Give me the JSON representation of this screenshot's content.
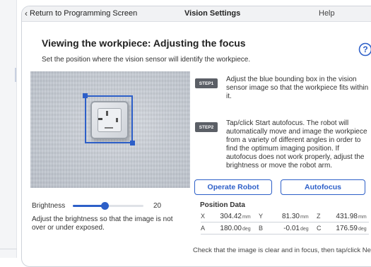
{
  "titlebar": {
    "back_label": "Return to Programming Screen",
    "screen_title": "Vision Settings",
    "help_label": "Help",
    "back_icon": "chevron-left-icon",
    "lock_icon": "lock-icon"
  },
  "page": {
    "heading": "Viewing the workpiece: Adjusting the focus",
    "subtitle": "Set the position where the vision sensor will identify the workpiece.",
    "help_icon": "question-circle-icon"
  },
  "camera": {
    "image_icon": "workpiece-image"
  },
  "brightness": {
    "label": "Brightness",
    "value": "20",
    "fraction": 0.45,
    "help_text": "Adjust the brightness so that the image is not over or under exposed."
  },
  "steps": [
    {
      "badge": "STEP1",
      "text": "Adjust the blue bounding box in the vision sensor image so that the workpiece fits within it."
    },
    {
      "badge": "STEP2",
      "text": "Tap/click Start autofocus. The robot will automatically move and image the workpiece from a variety of different angles in order to find the optimum imaging position. If autofocus does not work properly, adjust the brightness or move the robot arm."
    }
  ],
  "buttons": {
    "operate_robot": "Operate Robot",
    "autofocus": "Autofocus"
  },
  "position": {
    "title": "Position Data",
    "row1": [
      {
        "axis": "X",
        "value": "304.42",
        "unit": "mm"
      },
      {
        "axis": "Y",
        "value": "81.30",
        "unit": "mm"
      },
      {
        "axis": "Z",
        "value": "431.98",
        "unit": "mm"
      }
    ],
    "row2": [
      {
        "axis": "A",
        "value": "180.00",
        "unit": "deg"
      },
      {
        "axis": "B",
        "value": "-0.01",
        "unit": "deg"
      },
      {
        "axis": "C",
        "value": "176.59",
        "unit": "deg"
      }
    ]
  },
  "footer": {
    "note": "Check that the image is clear and in focus, then tap/click Ne"
  },
  "colors": {
    "accent": "#2d5fc8",
    "badge": "#5b5f66"
  }
}
